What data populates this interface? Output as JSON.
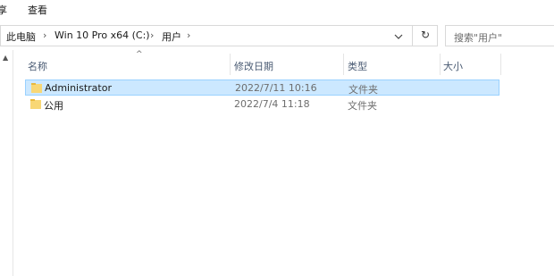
{
  "menu": {
    "items": [
      "享",
      "查看"
    ]
  },
  "address": {
    "crumbs": [
      "此电脑",
      "Win 10 Pro x64 (C:)",
      "用户"
    ],
    "separator": "›"
  },
  "search": {
    "placeholder": "搜索\"用户\""
  },
  "columns": {
    "name": "名称",
    "modified": "修改日期",
    "type": "类型",
    "size": "大小"
  },
  "files": [
    {
      "name": "Administrator",
      "modified": "2022/7/11 10:16",
      "type": "文件夹",
      "size": "",
      "selected": true
    },
    {
      "name": "公用",
      "modified": "2022/7/4 11:18",
      "type": "文件夹",
      "size": "",
      "selected": false
    }
  ],
  "colors": {
    "selection": "#cce8ff",
    "selection_border": "#99d1ff",
    "folder": "#f8d775",
    "header_text": "#4a5b73"
  },
  "icons": {
    "refresh": "refresh-icon",
    "dropdown": "chevron-down-icon",
    "folder": "folder-icon",
    "sort": "sort-ascending-icon"
  }
}
